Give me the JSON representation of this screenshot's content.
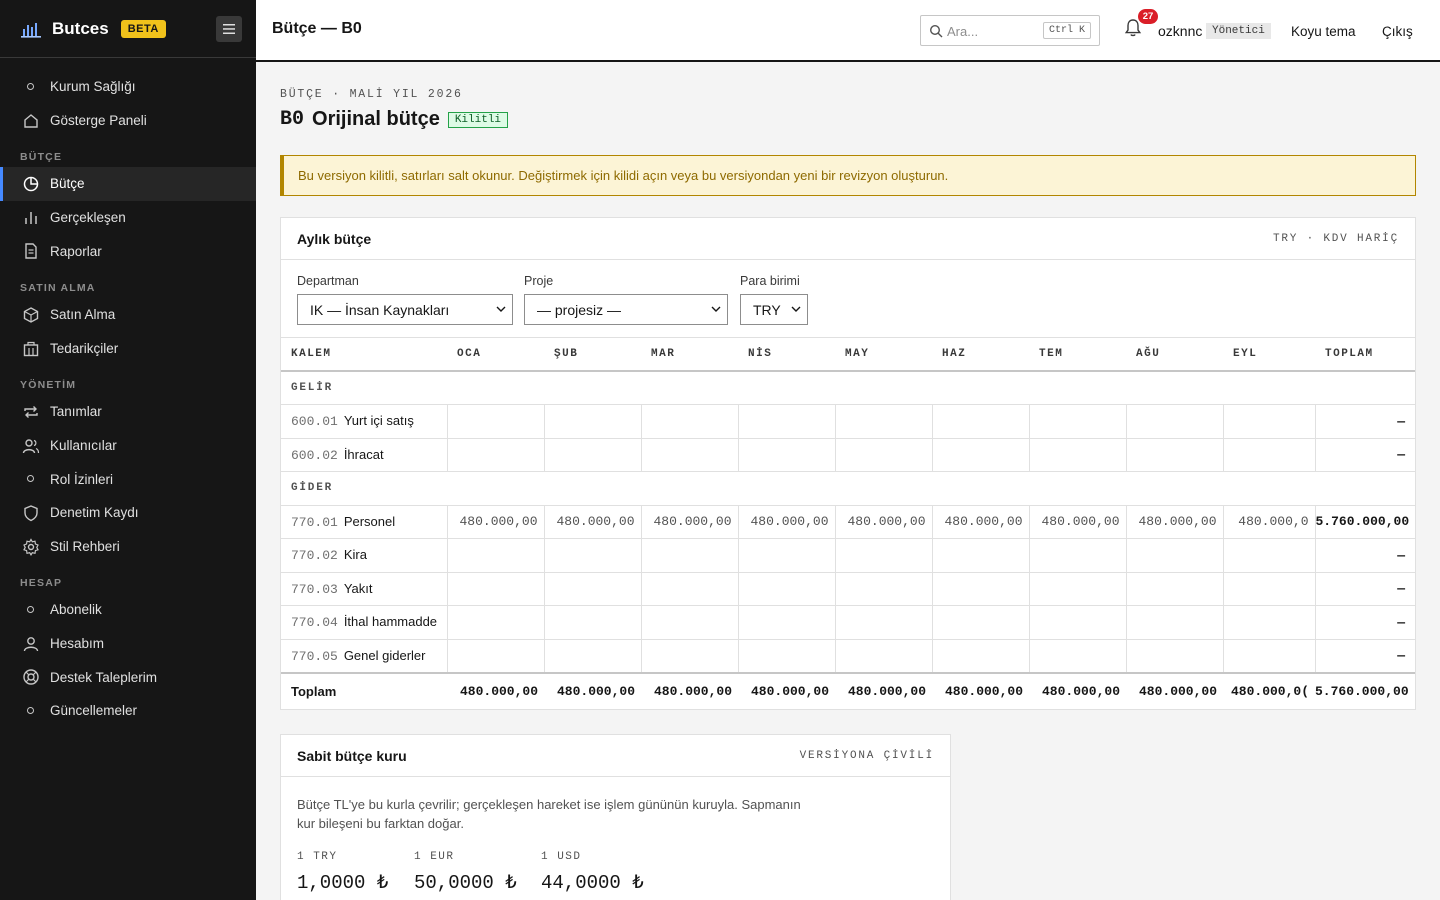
{
  "brand": {
    "name": "Butces",
    "badge": "BETA"
  },
  "sidebar": {
    "top": [
      {
        "label": "Kurum Sağlığı",
        "icon": "dot-icon"
      },
      {
        "label": "Gösterge Paneli",
        "icon": "home-icon"
      }
    ],
    "sections": [
      {
        "title": "BÜTÇE",
        "items": [
          {
            "label": "Bütçe",
            "icon": "pie-chart-icon",
            "active": true
          },
          {
            "label": "Gerçekleşen",
            "icon": "bar-chart-icon"
          },
          {
            "label": "Raporlar",
            "icon": "document-icon"
          }
        ]
      },
      {
        "title": "SATIN ALMA",
        "items": [
          {
            "label": "Satın Alma",
            "icon": "box-icon"
          },
          {
            "label": "Tedarikçiler",
            "icon": "building-icon"
          }
        ]
      },
      {
        "title": "YÖNETİM",
        "items": [
          {
            "label": "Tanımlar",
            "icon": "repeat-icon"
          },
          {
            "label": "Kullanıcılar",
            "icon": "users-icon"
          },
          {
            "label": "Rol İzinleri",
            "icon": "dot-icon"
          },
          {
            "label": "Denetim Kaydı",
            "icon": "shield-icon"
          },
          {
            "label": "Stil Rehberi",
            "icon": "gear-icon"
          }
        ]
      },
      {
        "title": "HESAP",
        "items": [
          {
            "label": "Abonelik",
            "icon": "dot-icon"
          },
          {
            "label": "Hesabım",
            "icon": "user-icon"
          },
          {
            "label": "Destek Taleplerim",
            "icon": "lifebuoy-icon"
          },
          {
            "label": "Güncellemeler",
            "icon": "dot-icon"
          }
        ]
      }
    ]
  },
  "header": {
    "title": "Bütçe — B0",
    "search_placeholder": "Ara...",
    "search_shortcut": "Ctrl K",
    "notifications": "27",
    "user": "ozknnc",
    "role": "Yönetici",
    "theme_link": "Koyu tema",
    "logout": "Çıkış"
  },
  "page": {
    "eyebrow": "BÜTÇE · MALİ YIL 2026",
    "version_code": "B0",
    "title": "Orijinal bütçe",
    "lock_badge": "Kilitli",
    "warning": "Bu versiyon kilitli, satırları salt okunur. Değiştirmek için kilidi açın veya bu versiyondan yeni bir revizyon oluşturun."
  },
  "monthly": {
    "title": "Aylık bütçe",
    "meta": "TRY · KDV HARİÇ",
    "filters": {
      "department": {
        "label": "Departman",
        "value": "IK — İnsan Kaynakları"
      },
      "project": {
        "label": "Proje",
        "value": "— projesiz —"
      },
      "currency": {
        "label": "Para birimi",
        "value": "TRY"
      }
    },
    "columns": [
      "KALEM",
      "OCA",
      "ŞUB",
      "MAR",
      "NİS",
      "MAY",
      "HAZ",
      "TEM",
      "AĞU",
      "EYL",
      "TOPLAM"
    ],
    "groups": [
      {
        "name": "GELİR",
        "rows": [
          {
            "code": "600.01",
            "name": "Yurt içi satış",
            "values": [
              "",
              "",
              "",
              "",
              "",
              "",
              "",
              "",
              ""
            ],
            "total": "—"
          },
          {
            "code": "600.02",
            "name": "İhracat",
            "values": [
              "",
              "",
              "",
              "",
              "",
              "",
              "",
              "",
              ""
            ],
            "total": "—"
          }
        ]
      },
      {
        "name": "GİDER",
        "rows": [
          {
            "code": "770.01",
            "name": "Personel",
            "values": [
              "480.000,00",
              "480.000,00",
              "480.000,00",
              "480.000,00",
              "480.000,00",
              "480.000,00",
              "480.000,00",
              "480.000,00",
              "480.000,0"
            ],
            "total": "5.760.000,00"
          },
          {
            "code": "770.02",
            "name": "Kira",
            "values": [
              "",
              "",
              "",
              "",
              "",
              "",
              "",
              "",
              ""
            ],
            "total": "—"
          },
          {
            "code": "770.03",
            "name": "Yakıt",
            "values": [
              "",
              "",
              "",
              "",
              "",
              "",
              "",
              "",
              ""
            ],
            "total": "—"
          },
          {
            "code": "770.04",
            "name": "İthal hammadde",
            "values": [
              "",
              "",
              "",
              "",
              "",
              "",
              "",
              "",
              ""
            ],
            "total": "—"
          },
          {
            "code": "770.05",
            "name": "Genel giderler",
            "values": [
              "",
              "",
              "",
              "",
              "",
              "",
              "",
              "",
              ""
            ],
            "total": "—"
          }
        ]
      }
    ],
    "footer": {
      "label": "Toplam",
      "values": [
        "480.000,00",
        "480.000,00",
        "480.000,00",
        "480.000,00",
        "480.000,00",
        "480.000,00",
        "480.000,00",
        "480.000,00",
        "480.000,0("
      ],
      "total": "5.760.000,00"
    }
  },
  "fx": {
    "title": "Sabit bütçe kuru",
    "meta": "VERSİYONA ÇİVİLİ",
    "description": "Bütçe TL'ye bu kurla çevrilir; gerçekleşen hareket ise işlem gününün kuruyla. Sapmanın kur bileşeni bu farktan doğar.",
    "rates": [
      {
        "label": "1 TRY",
        "value": "1,0000 ₺"
      },
      {
        "label": "1 EUR",
        "value": "50,0000 ₺"
      },
      {
        "label": "1 USD",
        "value": "44,0000 ₺"
      }
    ]
  }
}
